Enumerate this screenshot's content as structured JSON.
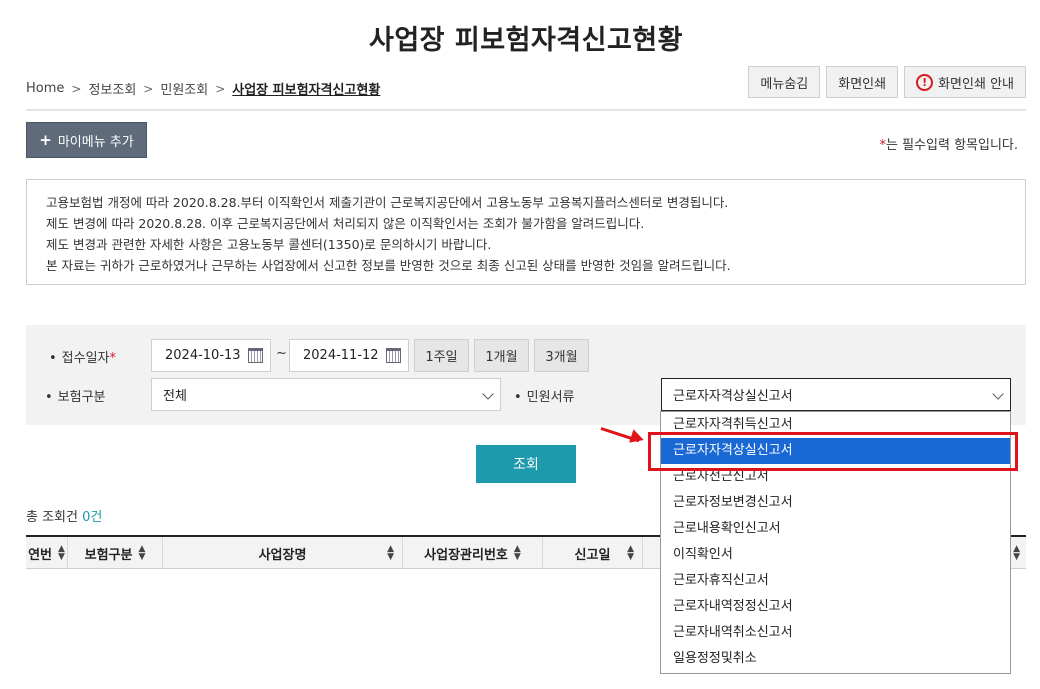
{
  "page_title": "사업장 피보험자격신고현황",
  "breadcrumb": [
    "Home",
    "정보조회",
    "민원조회",
    "사업장 피보험자격신고현황"
  ],
  "top_buttons": {
    "hide_menu": "메뉴숨김",
    "print": "화면인쇄",
    "print_guide": "화면인쇄 안내"
  },
  "my_menu_label": "마이메뉴 추가",
  "required_note": {
    "star": "*",
    "text": "는 필수입력 항목입니다."
  },
  "notice_lines": [
    "고용보험법 개정에 따라 2020.8.28.부터 이직확인서 제출기관이 근로복지공단에서 고용노동부 고용복지플러스센터로 변경됩니다.",
    "제도 변경에 따라 2020.8.28. 이후 근로복지공단에서 처리되지 않은 이직확인서는 조회가 불가함을 알려드립니다.",
    "제도 변경과 관련한 자세한 사항은 고용노동부 콜센터(1350)로 문의하시기 바랍니다.",
    "본 자료는 귀하가 근로하였거나 근무하는 사업장에서 신고한 정보를 반영한 것으로 최종 신고된 상태를 반영한 것임을 알려드립니다."
  ],
  "search": {
    "date_label": "접수일자",
    "date_from": "2024-10-13",
    "date_sep": "~",
    "date_to": "2024-11-12",
    "periods": [
      "1주일",
      "1개월",
      "3개월"
    ],
    "insurance_label": "보험구분",
    "insurance_value": "전체",
    "doc_label": "민원서류",
    "doc_value": "근로자자격상실신고서",
    "doc_options": [
      "근로자자격취득신고서",
      "근로자자격상실신고서",
      "근로자전근신고서",
      "근로자정보변경신고서",
      "근로내용확인신고서",
      "이직확인서",
      "근로자휴직신고서",
      "근로자내역정정신고서",
      "근로자내역취소신고서",
      "일용정정및취소"
    ],
    "selected_index": 1,
    "search_button": "조회"
  },
  "total": {
    "label": "총 조회건",
    "count": "0건"
  },
  "table_headers": [
    "연번",
    "보험구분",
    "사업장명",
    "사업장관리번호",
    "신고일"
  ],
  "colors": {
    "accent": "#1d9aab",
    "highlight": "#e0131b",
    "selected": "#1a68d4"
  }
}
